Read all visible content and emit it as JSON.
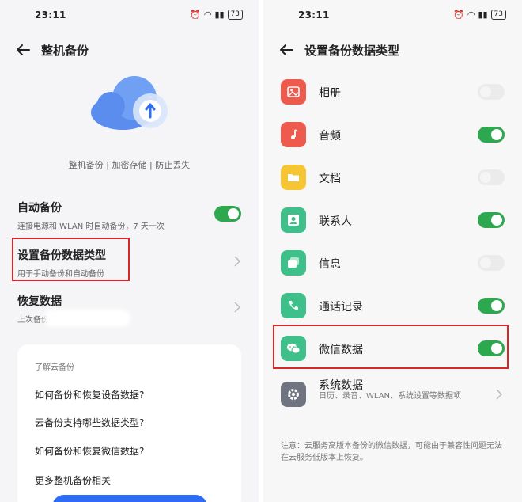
{
  "left": {
    "status": {
      "time": "23:11",
      "battery": "73"
    },
    "title": "整机备份",
    "tagline": "整机备份 | 加密存储 | 防止丢失",
    "auto_backup": {
      "title": "自动备份",
      "desc": "连接电源和 WLAN 时自动备份，7 天一次",
      "on": true
    },
    "set_type": {
      "title": "设置备份数据类型",
      "desc": "用于手动备份和自动备份"
    },
    "restore": {
      "title": "恢复数据",
      "desc": "上次备份"
    },
    "faq": {
      "heading": "了解云备份",
      "items": [
        "如何备份和恢复设备数据?",
        "云备份支持哪些数据类型?",
        "如何备份和恢复微信数据?",
        "更多整机备份相关"
      ]
    }
  },
  "right": {
    "status": {
      "time": "23:11",
      "battery": "73"
    },
    "title": "设置备份数据类型",
    "rows": [
      {
        "label": "相册",
        "on": false,
        "icon": "photo-icon",
        "color": "#ee5a4e"
      },
      {
        "label": "音频",
        "on": true,
        "icon": "music-note-icon",
        "color": "#ee5a4e"
      },
      {
        "label": "文档",
        "on": false,
        "icon": "folder-icon",
        "color": "#f6c534"
      },
      {
        "label": "联系人",
        "on": true,
        "icon": "contact-icon",
        "color": "#3fc08a"
      },
      {
        "label": "信息",
        "on": false,
        "icon": "message-icon",
        "color": "#3fc08a"
      },
      {
        "label": "通话记录",
        "on": true,
        "icon": "phone-icon",
        "color": "#3fc08a"
      },
      {
        "label": "微信数据",
        "on": true,
        "icon": "wechat-icon",
        "color": "#3fc08a"
      }
    ],
    "system": {
      "label": "系统数据",
      "desc": "日历、录音、WLAN、系统设置等数据项",
      "icon": "gear-icon",
      "color": "#6f7480"
    },
    "note": "注意：云服务高版本备份的微信数据，可能由于兼容性问题无法在云服务低版本上恢复。"
  },
  "colors": {
    "accent": "#2ea84f",
    "highlight": "#d8262d",
    "primary_button": "#2f6cf6"
  }
}
